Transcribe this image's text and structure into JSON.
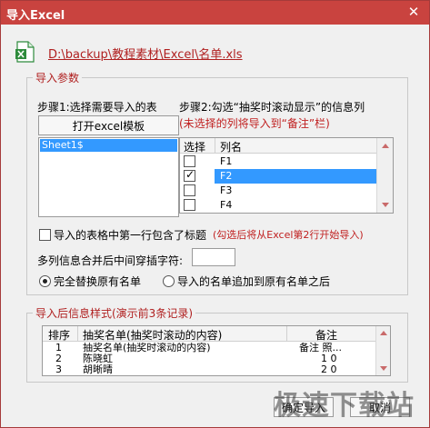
{
  "window": {
    "title": "导入Excel",
    "close_glyph": "✕"
  },
  "file": {
    "path": "D:\\backup\\教程素材\\Excel\\名单.xls"
  },
  "import_params": {
    "legend": "导入参数",
    "step1": "步骤1:选择需要导入的表",
    "open_template_button": "打开excel模板",
    "sheets": [
      "Sheet1$"
    ],
    "step2": "步骤2:勾选“抽奖时滚动显示”的信息列",
    "step2_note": "(未选择的列将导入到“备注”栏)",
    "columns_header": {
      "select": "选择",
      "name": "列名"
    },
    "columns": [
      {
        "name": "F1",
        "checked": false
      },
      {
        "name": "F2",
        "checked": true
      },
      {
        "name": "F3",
        "checked": false
      },
      {
        "name": "F4",
        "checked": false
      }
    ],
    "header_row_checkbox": "导入的表格中第一行包含了标题",
    "header_row_note": "(勾选后将从Excel第2行开始导入)",
    "separator_label": "多列信息合并后中间穿插字符:",
    "separator_value": "",
    "radio_replace": "完全替换原有名单",
    "radio_append": "导入的名单追加到原有名单之后"
  },
  "preview": {
    "legend": "导入后信息样式(演示前3条记录)",
    "headers": {
      "index": "排序",
      "name": "抽奖名单(抽奖时滚动的内容)",
      "note": "备注"
    },
    "rows": [
      {
        "index": "1",
        "name": "抽奖名单(抽奖时滚动的内容)",
        "note": "备注 照..."
      },
      {
        "index": "2",
        "name": "陈晓虹",
        "note": "1 0"
      },
      {
        "index": "3",
        "name": "胡晰晴",
        "note": "2 0"
      }
    ]
  },
  "footer": {
    "ok_button": "确定导入",
    "cancel_button": "取消"
  },
  "watermark": "极速下载站",
  "colors": {
    "titlebar": "#c9433f",
    "accent_red": "#c02020",
    "selection": "#3399ff"
  }
}
